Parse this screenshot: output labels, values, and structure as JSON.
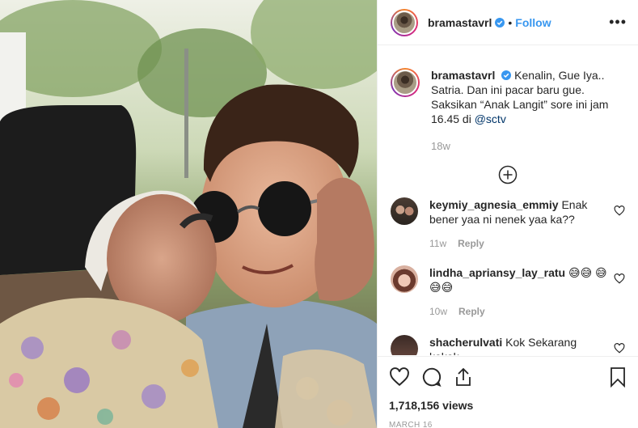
{
  "post": {
    "username": "bramastavrl",
    "follow_label": "Follow",
    "dot": "•",
    "more_label": "•••"
  },
  "caption": {
    "username": "bramastavrl",
    "text": "Kenalin, Gue Iya.. Satria. Dan ini pacar baru gue. Saksikan “Anak Langit” sore ini jam 16.45 di ",
    "mention": "@sctv",
    "time": "18w"
  },
  "comments": [
    {
      "username": "keymiy_agnesia_emmiy",
      "text": "Enak bener yaa ni nenek yaa ka??",
      "time": "11w",
      "reply": "Reply"
    },
    {
      "username": "lindha_apriansy_lay_ratu",
      "text": "😅😅 😅😅😅",
      "time": "10w",
      "reply": "Reply"
    },
    {
      "username": "shacherulvati",
      "text": "Kok Sekarang kakak",
      "time": "",
      "reply": ""
    }
  ],
  "stats": {
    "views": "1,718,156 views",
    "date": "MARCH 16"
  },
  "icons": {
    "like": "heart-icon",
    "comment": "comment-icon",
    "share": "share-icon",
    "save": "bookmark-icon",
    "load_more": "plus-circle-icon"
  },
  "colors": {
    "accent": "#3897f0",
    "muted": "#999999",
    "text": "#262626"
  }
}
